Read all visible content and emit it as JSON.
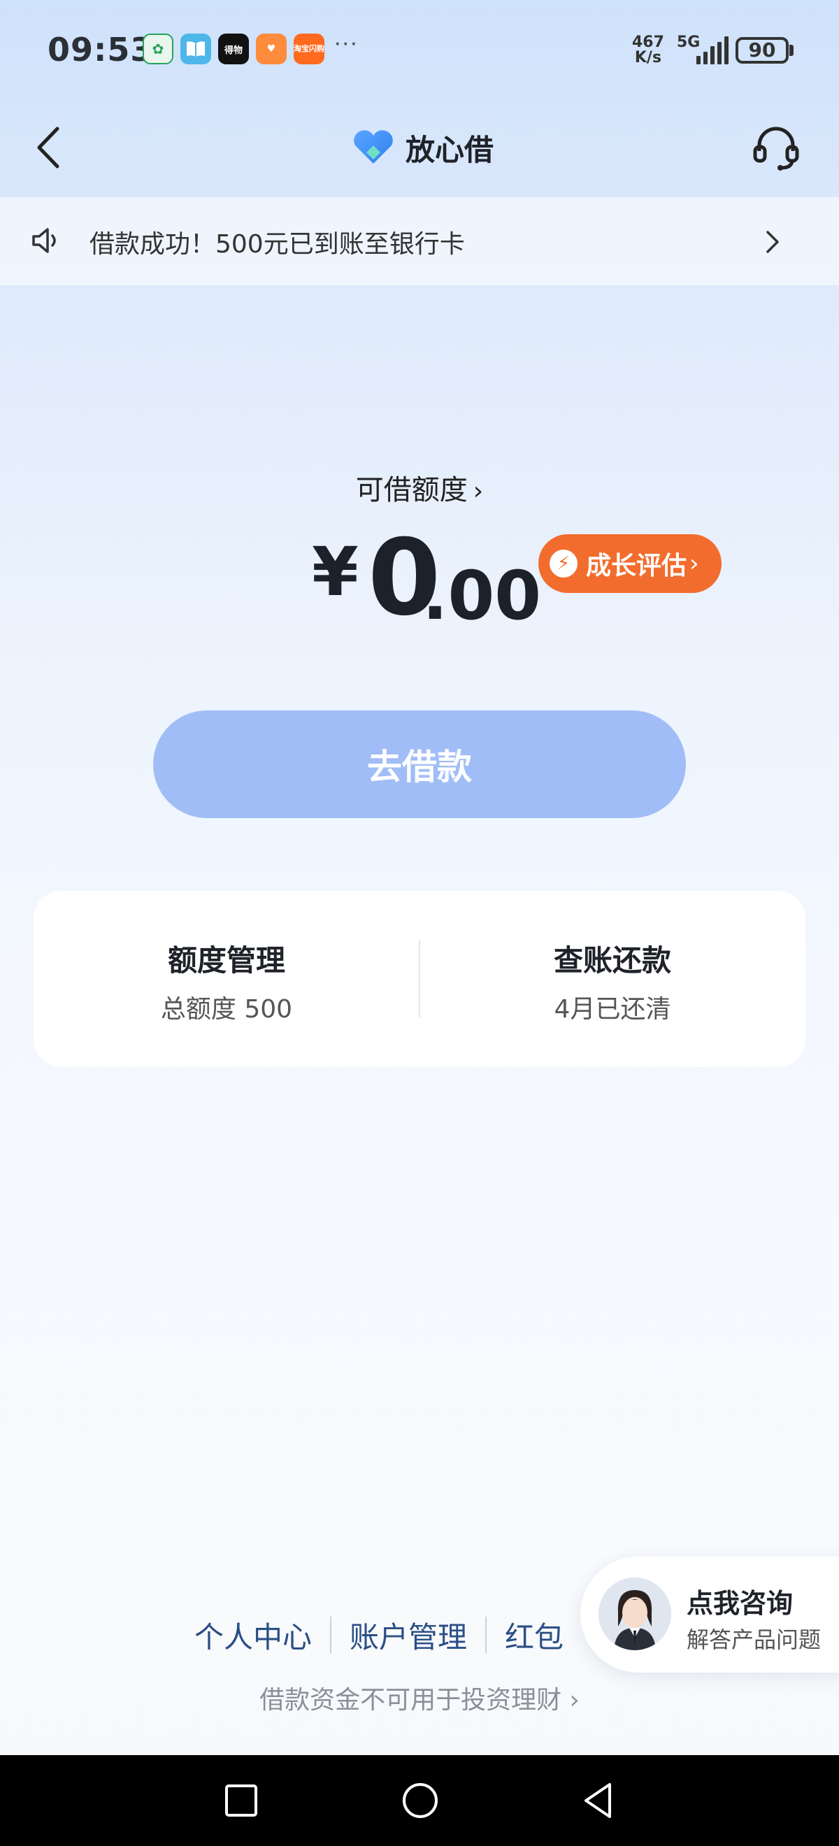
{
  "status_bar": {
    "time": "09:53",
    "net_speed_value": "467",
    "net_speed_unit": "K/s",
    "network": "5G",
    "battery": "90",
    "more": "···",
    "app_icons": [
      {
        "name": "green-app-icon",
        "glyph": "✿"
      },
      {
        "name": "book-app-icon",
        "glyph": "📖"
      },
      {
        "name": "dewu-app-icon",
        "glyph": "得物"
      },
      {
        "name": "heart-app-icon",
        "glyph": "♥"
      },
      {
        "name": "taobao-flash-app-icon",
        "glyph": "淘宝闪购"
      }
    ]
  },
  "nav": {
    "title": "放心借",
    "brand_color": "#3b8cf5"
  },
  "notice": {
    "text": "借款成功！500元已到账至银行卡"
  },
  "limit": {
    "label": "可借额度",
    "currency": "¥",
    "amount_int": "0",
    "amount_dec": ".00",
    "growth_label": "成长评估"
  },
  "borrow_button": {
    "label": "去借款"
  },
  "card": {
    "left_title": "额度管理",
    "left_sub": "总额度 500",
    "right_title": "查账还款",
    "right_sub": "4月已还清"
  },
  "bottom": {
    "links": [
      "个人中心",
      "账户管理",
      "红包"
    ],
    "disclaimer": "借款资金不可用于投资理财"
  },
  "consult": {
    "title": "点我咨询",
    "subtitle": "解答产品问题"
  },
  "colors": {
    "accent_orange": "#f26d2d",
    "button_blue": "#a1bdf7",
    "link_blue": "#2b4f86"
  }
}
